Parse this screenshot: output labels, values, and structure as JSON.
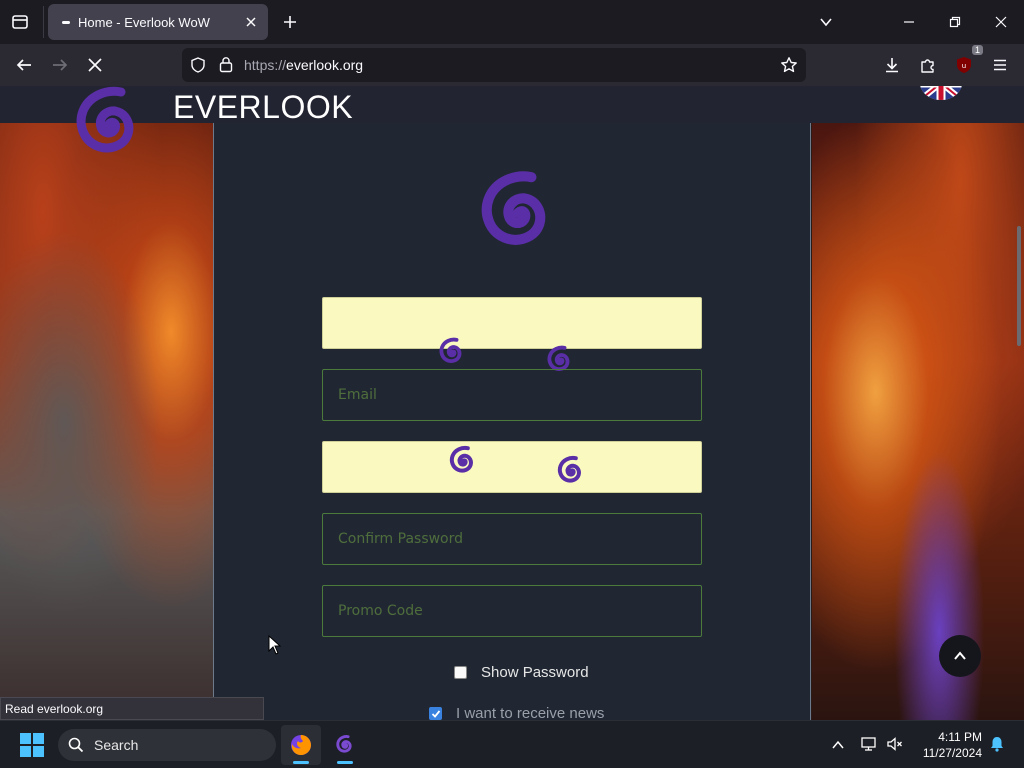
{
  "browser": {
    "tab_title": "Home - Everlook WoW",
    "url_scheme": "https://",
    "url_host": "everlook.org",
    "extension_badge": "1"
  },
  "site": {
    "name": "EVERLOOK"
  },
  "form": {
    "email_placeholder": "Email",
    "confirm_password_placeholder": "Confirm Password",
    "promo_code_placeholder": "Promo Code",
    "show_password_label": "Show Password",
    "show_password_checked": false,
    "news_label": "I want to receive news",
    "news_checked": true
  },
  "status_text": "Read everlook.org",
  "taskbar": {
    "search_label": "Search",
    "time": "4:11 PM",
    "date": "11/27/2024"
  },
  "colors": {
    "brand_purple": "#5a2ea6",
    "autofill_yellow": "#fafac0",
    "field_border_green": "#4c7a3c",
    "accent_blue": "#4cc2ff"
  }
}
